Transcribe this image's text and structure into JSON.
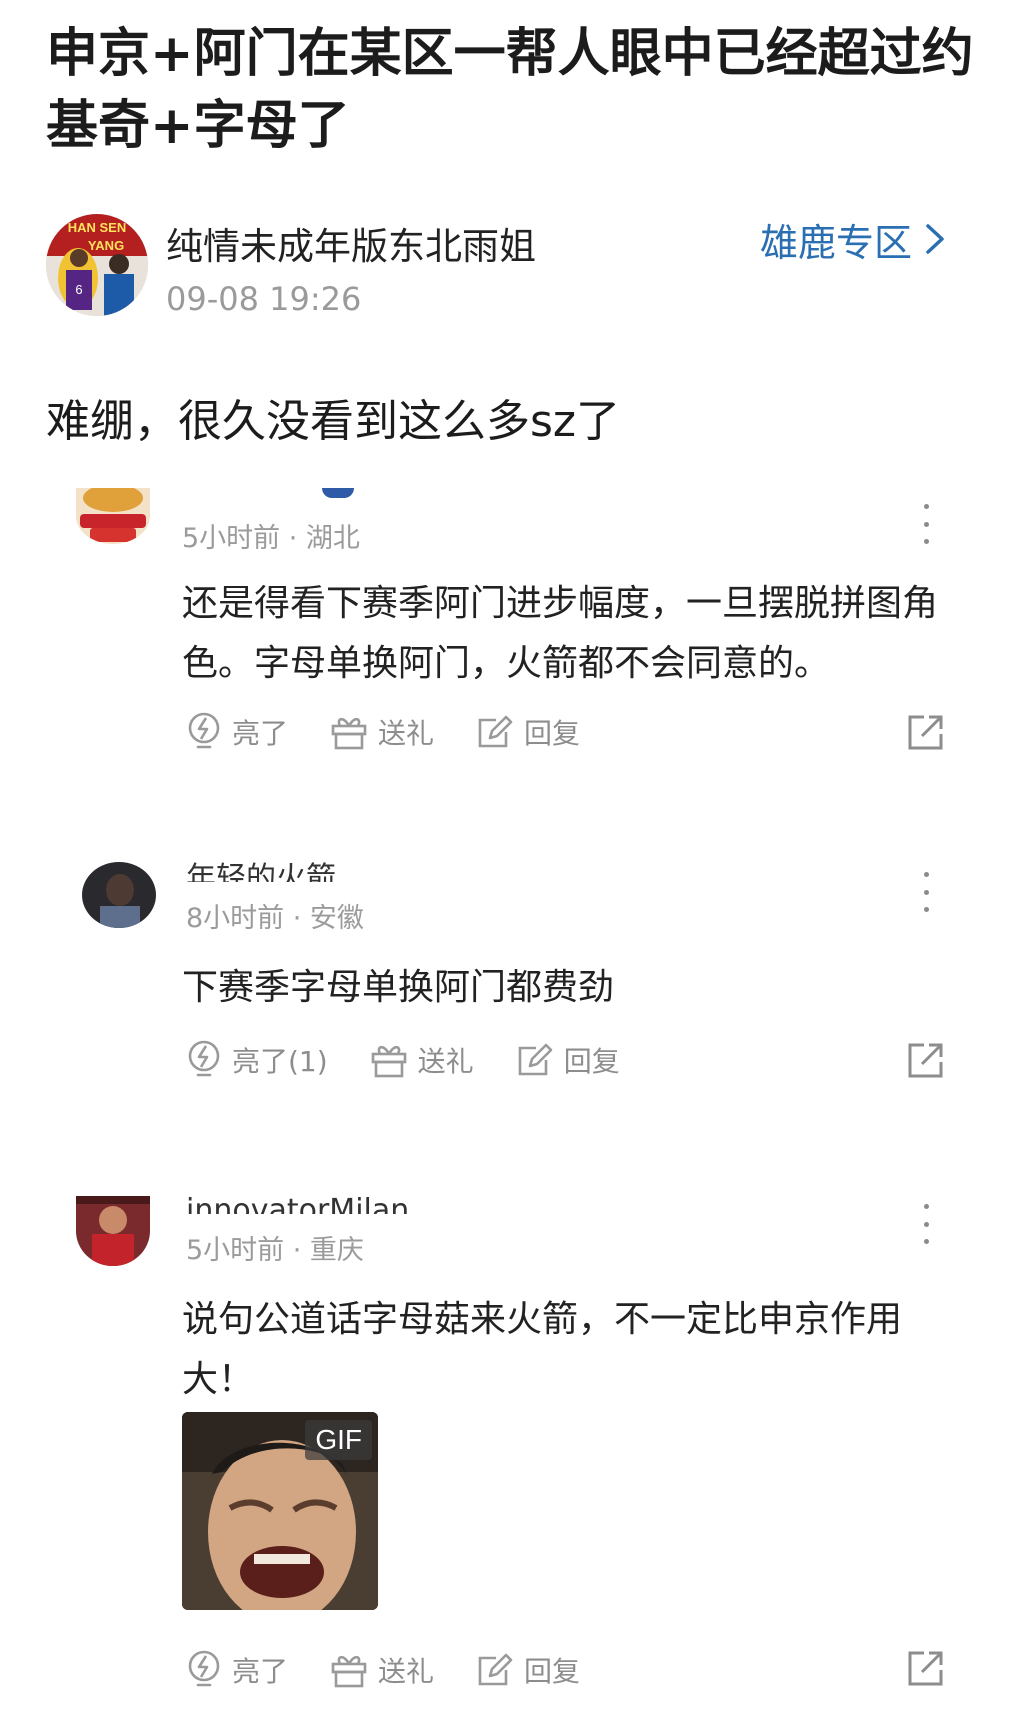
{
  "post": {
    "title": "申京+阿门在某区一帮人眼中已经超过约基奇+字母了",
    "author": "纯情未成年版东北雨姐",
    "time": "09-08 19:26",
    "zone": "雄鹿专区",
    "body": "难绷，很久没看到这么多sz了",
    "avatar_text_1": "HAN SEN",
    "avatar_text_2": "YANG"
  },
  "comments": [
    {
      "name": "",
      "meta": "5小时前 · 湖北",
      "text": "还是得看下赛季阿门进步幅度，一旦摆脱拼图角色。字母单换阿门，火箭都不会同意的。",
      "like": "亮了",
      "gift": "送礼",
      "reply": "回复"
    },
    {
      "name": "年轻的火箭",
      "meta": "8小时前 · 安徽",
      "text": "下赛季字母单换阿门都费劲",
      "like": "亮了(1)",
      "gift": "送礼",
      "reply": "回复"
    },
    {
      "name": "innovatorMilan",
      "meta": "5小时前 · 重庆",
      "text": "说句公道话字母菇来火箭，不一定比申京作用大！",
      "like": "亮了",
      "gift": "送礼",
      "reply": "回复",
      "gif_badge": "GIF"
    }
  ],
  "colors": {
    "accent_link": "#2b6fb3",
    "meta_gray": "#9b9b9b",
    "icon_gray": "#8d8d8d"
  }
}
